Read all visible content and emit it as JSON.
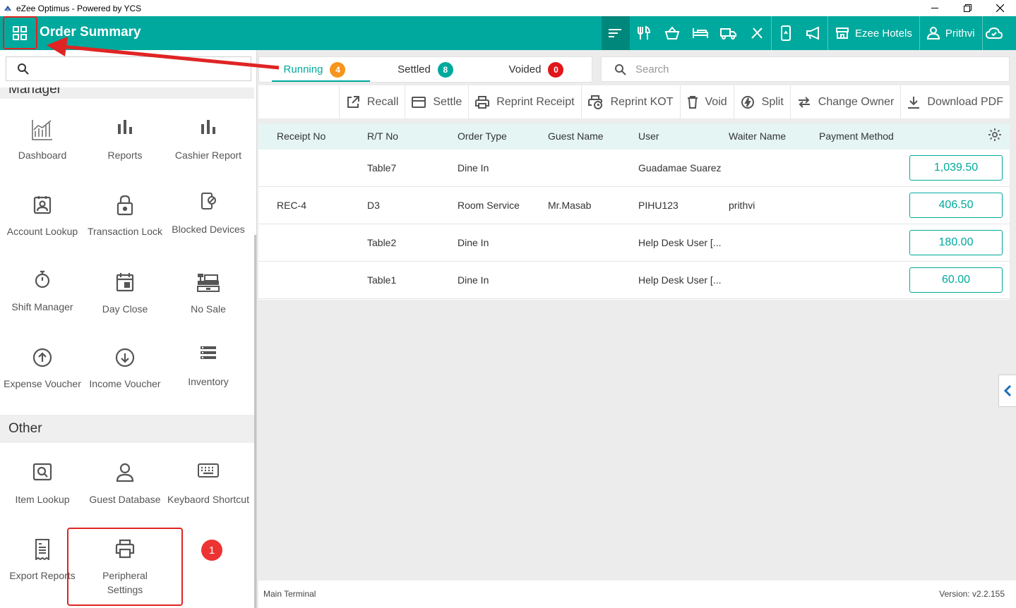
{
  "window": {
    "title": "eZee Optimus - Powered by YCS"
  },
  "header": {
    "title": "Order Summary",
    "property": "Ezee Hotels",
    "user": "Prithvi"
  },
  "sidebar": {
    "search_placeholder": "",
    "manager_label": "Manager",
    "manager_items": [
      {
        "label": "Dashboard",
        "icon": "dashboard-chart-icon"
      },
      {
        "label": "Reports",
        "icon": "bar-chart-icon"
      },
      {
        "label": "Cashier Report",
        "icon": "bar-chart-icon"
      },
      {
        "label": "Account Lookup",
        "icon": "account-badge-icon"
      },
      {
        "label": "Transaction Lock",
        "icon": "lock-icon"
      },
      {
        "label": "Blocked Devices",
        "icon": "blocked-device-icon"
      },
      {
        "label": "Shift Manager",
        "icon": "stopwatch-icon"
      },
      {
        "label": "Day Close",
        "icon": "calendar-icon"
      },
      {
        "label": "No Sale",
        "icon": "cash-register-icon"
      },
      {
        "label": "Expense Voucher",
        "icon": "arrow-up-circle-icon"
      },
      {
        "label": "Income Voucher",
        "icon": "arrow-down-circle-icon"
      },
      {
        "label": "Inventory",
        "icon": "list-icon"
      }
    ],
    "other_label": "Other",
    "other_items": [
      {
        "label": "Item Lookup",
        "icon": "item-lookup-icon"
      },
      {
        "label": "Guest Database",
        "icon": "person-icon"
      },
      {
        "label": "Keybaord Shortcut",
        "icon": "keyboard-icon"
      },
      {
        "label": "Export Reports",
        "icon": "receipt-icon"
      },
      {
        "label": "Peripheral Settings",
        "icon": "printer-icon"
      }
    ]
  },
  "tabs": [
    {
      "label": "Running",
      "count": "4",
      "color": "#f7941d"
    },
    {
      "label": "Settled",
      "count": "8",
      "color": "#00a99d"
    },
    {
      "label": "Voided",
      "count": "0",
      "color": "#e0161b"
    }
  ],
  "search": {
    "placeholder": "Search"
  },
  "toolbar": {
    "recall": "Recall",
    "settle": "Settle",
    "reprint_receipt": "Reprint Receipt",
    "reprint_kot": "Reprint KOT",
    "void": "Void",
    "split": "Split",
    "change_owner": "Change Owner",
    "download_pdf": "Download PDF"
  },
  "table": {
    "columns": [
      "Receipt No",
      "R/T No",
      "Order Type",
      "Guest Name",
      "User",
      "Waiter Name",
      "Payment Method"
    ],
    "rows": [
      {
        "receipt": "",
        "rt": "Table7",
        "type": "Dine In",
        "guest": "",
        "user": "Guadamae Suarez",
        "waiter": "",
        "payment": "",
        "amount": "1,039.50"
      },
      {
        "receipt": "REC-4",
        "rt": "D3",
        "type": "Room Service",
        "guest": "Mr.Masab",
        "user": "PIHU123",
        "waiter": "prithvi",
        "payment": "",
        "amount": "406.50"
      },
      {
        "receipt": "",
        "rt": "Table2",
        "type": "Dine In",
        "guest": "",
        "user": "Help Desk User [...",
        "waiter": "",
        "payment": "",
        "amount": "180.00"
      },
      {
        "receipt": "",
        "rt": "Table1",
        "type": "Dine In",
        "guest": "",
        "user": "Help Desk User [...",
        "waiter": "",
        "payment": "",
        "amount": "60.00"
      }
    ]
  },
  "footer": {
    "terminal": "Main Terminal",
    "version": "Version: v2.2.155"
  },
  "annotation": {
    "step": "1"
  },
  "colors": {
    "accent": "#00a99d",
    "accent_dark": "#00877c",
    "annotation": "#e02424"
  }
}
